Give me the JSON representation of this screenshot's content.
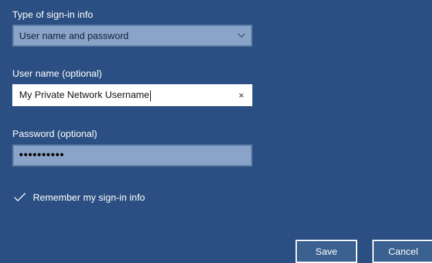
{
  "form": {
    "signin_type": {
      "label": "Type of sign-in info",
      "selected": "User name and password"
    },
    "username": {
      "label": "User name (optional)",
      "value": "My Private Network Username",
      "clear_icon": "×"
    },
    "password": {
      "label": "Password (optional)",
      "value": "••••••••••"
    },
    "remember": {
      "label": "Remember my sign-in info",
      "checked": true
    }
  },
  "buttons": {
    "save_label": "Save",
    "cancel_label": "Cancel"
  },
  "colors": {
    "background": "#2b4f82",
    "field_fill": "#8aa3c8",
    "field_border": "#5f7fa9"
  }
}
